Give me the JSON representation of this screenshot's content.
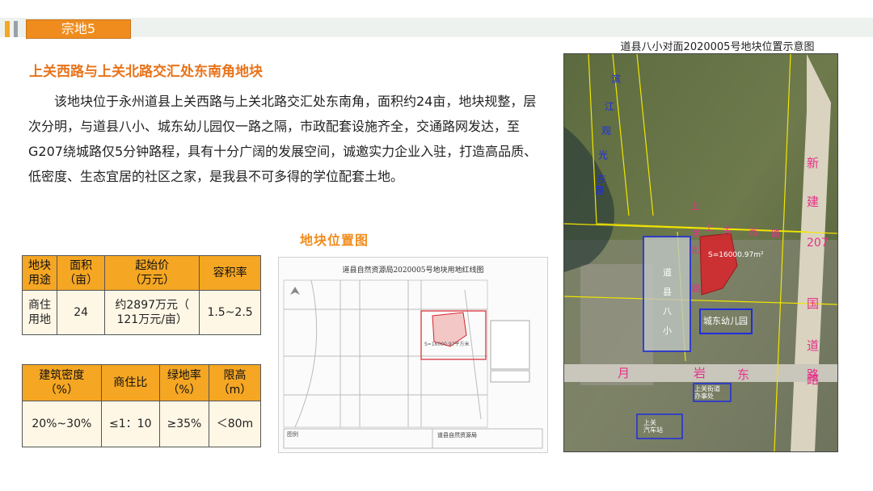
{
  "header": {
    "tag": "宗地5"
  },
  "subtitle": "上关西路与上关北路交汇处东南角地块",
  "description": "该地块位于永州道县上关西路与上关北路交汇处东南角，面积约24亩，地块规整，层次分明，与道县八小、城东幼儿园仅一路之隔，市政配套设施齐全，交通路网发达，至G207绕城路仅5分钟路程，具有十分广阔的发展空间，诚邀实力企业入驻，打造高品质、低密度、生态宜居的社区之家，是我县不可多得的学位配套土地。",
  "map_caption": "地块位置图",
  "table1": {
    "headers": [
      "地块\n用途",
      "面积\n（亩）",
      "起始价\n（万元）",
      "容积率"
    ],
    "row": [
      "商住\n用地",
      "24",
      "约2897万元（\n121万元/亩）",
      "1.5~2.5"
    ]
  },
  "table2": {
    "headers": [
      "建筑密度\n（%）",
      "商住比",
      "绿地率\n（%）",
      "限高\n（m）"
    ],
    "row": [
      "20%~30%",
      "≤1：10",
      "≥35%",
      "＜80m"
    ]
  },
  "plan": {
    "title": "道县自然资源局2020005号地块用地红线图",
    "area_label": "S=16000.97平方米",
    "legend_title": "图例",
    "bureau": "道县自然资源局"
  },
  "satellite": {
    "title": "道县八小对面2020005号地块位置示意图",
    "area_label": "S=16000.97m²",
    "school_chars": [
      "道",
      "县",
      "八",
      "小"
    ],
    "kindergarten": "城东幼儿园",
    "road_left": [
      "滨",
      "江",
      "观",
      "光",
      "东",
      "路"
    ],
    "road_right": [
      "新",
      "建",
      "207",
      "国",
      "道",
      "路"
    ],
    "road_bottom": [
      "月",
      "岩",
      "东",
      "路"
    ],
    "road_top": [
      "上",
      "关",
      "北",
      "路"
    ],
    "road_mid": [
      "上",
      "关",
      "西",
      "路"
    ],
    "office": "上关街道\n办事处",
    "station": "上关\n汽车站"
  },
  "colors": {
    "accent": "#f08c1d",
    "subtitle": "#e8731a",
    "table_header": "#f5a623",
    "table_body": "#fff7e6",
    "parcel": "#d9232b",
    "school_outline": "#1f2de0",
    "road_label": "#e8308a"
  }
}
